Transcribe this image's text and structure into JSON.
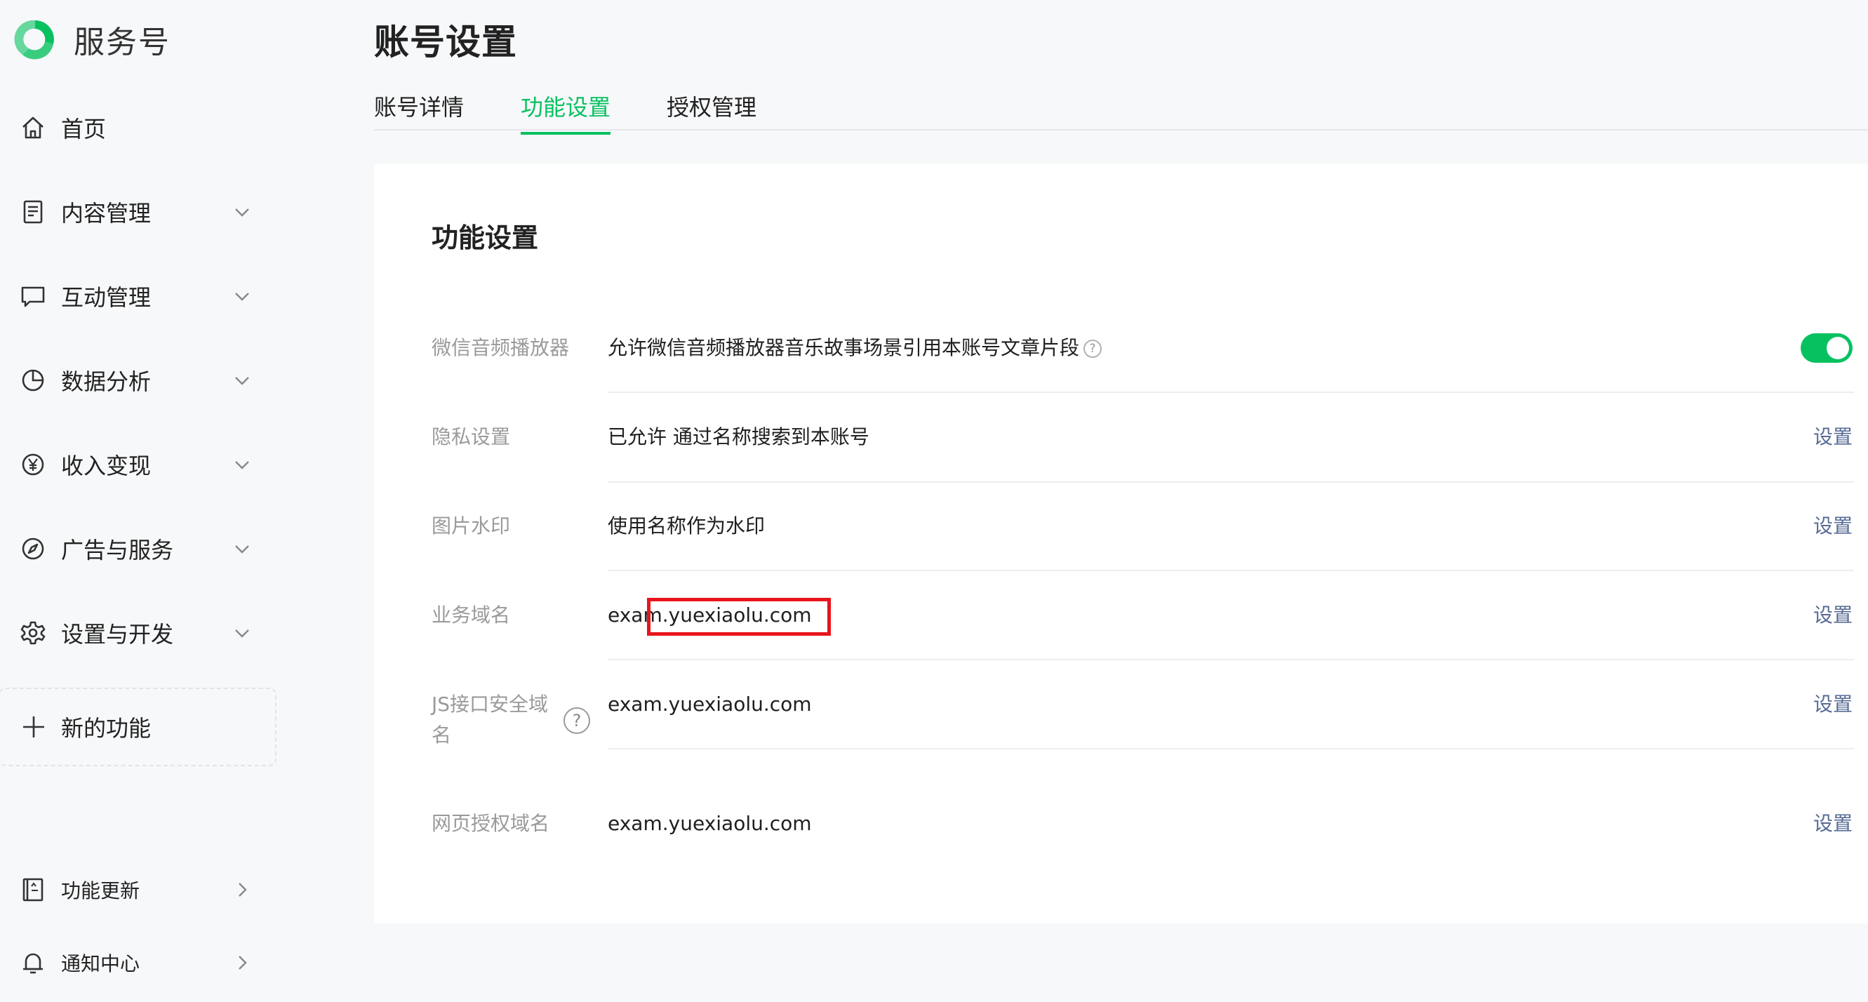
{
  "brand": {
    "name": "服务号",
    "logo_icon": "wechat-service-logo",
    "color": "#07c160"
  },
  "sidebar": {
    "items": [
      {
        "key": "home",
        "label": "首页",
        "icon": "home-icon",
        "has_children": false
      },
      {
        "key": "content",
        "label": "内容管理",
        "icon": "document-icon",
        "has_children": true
      },
      {
        "key": "interaction",
        "label": "互动管理",
        "icon": "chat-bubble-icon",
        "has_children": true
      },
      {
        "key": "analytics",
        "label": "数据分析",
        "icon": "pie-chart-icon",
        "has_children": true
      },
      {
        "key": "income",
        "label": "收入变现",
        "icon": "yen-icon",
        "has_children": true
      },
      {
        "key": "ads",
        "label": "广告与服务",
        "icon": "compass-icon",
        "has_children": true
      },
      {
        "key": "settings",
        "label": "设置与开发",
        "icon": "gear-icon",
        "has_children": true
      }
    ],
    "new_feature": {
      "label": "新的功能",
      "icon": "plus-icon"
    },
    "bottom": [
      {
        "key": "updates",
        "label": "功能更新",
        "icon": "book-icon"
      },
      {
        "key": "notifications",
        "label": "通知中心",
        "icon": "bell-icon"
      }
    ]
  },
  "page": {
    "title": "账号设置",
    "tabs": [
      {
        "label": "账号详情",
        "active": false
      },
      {
        "label": "功能设置",
        "active": true
      },
      {
        "label": "授权管理",
        "active": false
      }
    ]
  },
  "card": {
    "title": "功能设置",
    "rows": [
      {
        "key": "audio-player",
        "label": "微信音频播放器",
        "value": "允许微信音频播放器音乐故事场景引用本账号文章片段",
        "control": "toggle",
        "toggle_on": true
      },
      {
        "key": "privacy",
        "label": "隐私设置",
        "value": "已允许 通过名称搜索到本账号",
        "action": "设置"
      },
      {
        "key": "watermark",
        "label": "图片水印",
        "value": "使用名称作为水印",
        "action": "设置"
      },
      {
        "key": "business-domain",
        "label": "业务域名",
        "value": "exam.yuexiaolu.com",
        "action": "设置"
      },
      {
        "key": "js-domain",
        "label": "JS接口安全域名",
        "value": "exam.yuexiaolu.com",
        "action": "设置"
      },
      {
        "key": "oauth-domain",
        "label": "网页授权域名",
        "value": "exam.yuexiaolu.com",
        "action": "设置"
      }
    ]
  },
  "colors": {
    "accent": "#07c160",
    "link": "#576b95",
    "highlight": "#e8141c"
  }
}
